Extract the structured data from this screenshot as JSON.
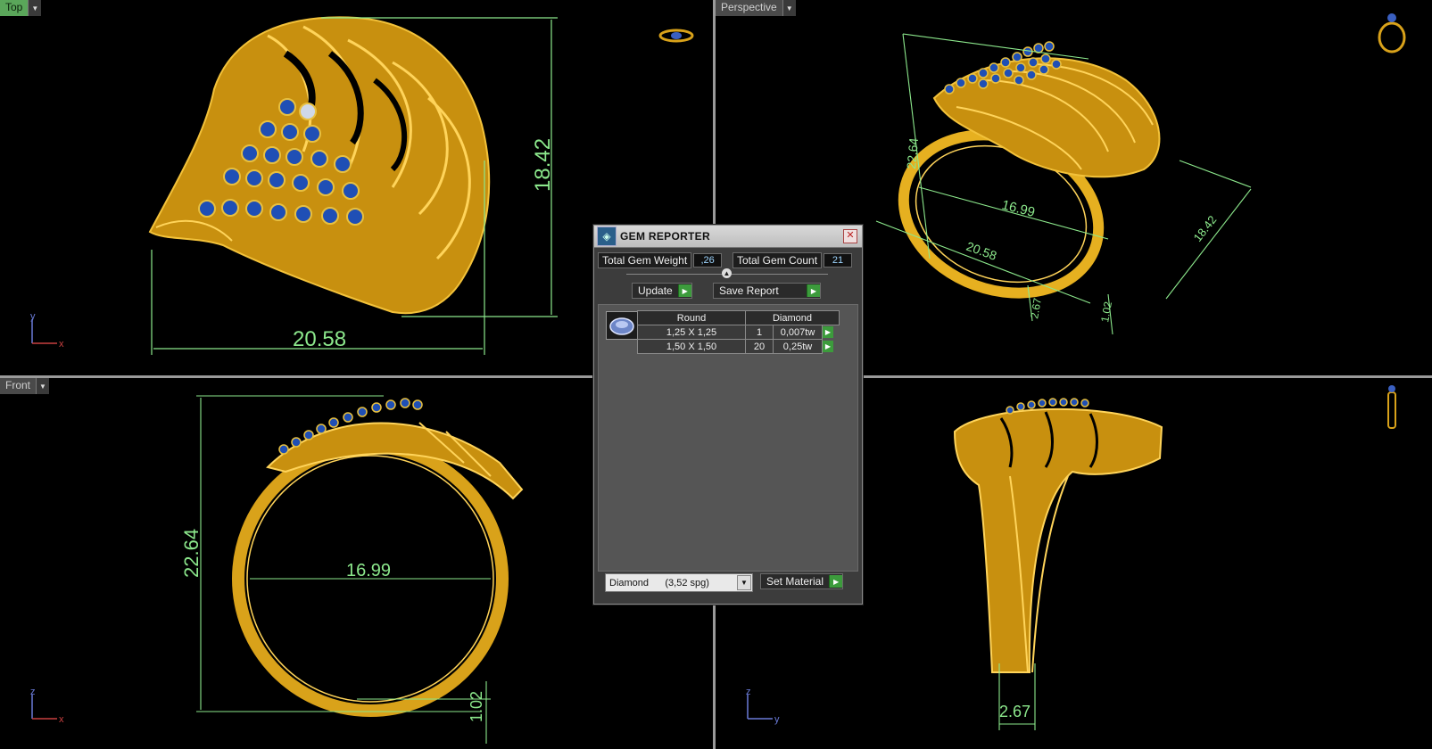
{
  "viewports": {
    "top": {
      "label": "Top",
      "dims": {
        "width": "20.58",
        "height": "18.42"
      },
      "axes": {
        "a": "y",
        "b": "x"
      }
    },
    "perspective": {
      "label": "Perspective",
      "dims": {
        "a": "22.64",
        "b": "16.99",
        "c": "20.58",
        "d": "18.42",
        "e": "2.67",
        "f": "1.02"
      }
    },
    "front": {
      "label": "Front",
      "dims": {
        "height": "22.64",
        "inner": "16.99",
        "bottom": "1.02"
      },
      "axes": {
        "a": "z",
        "b": "x"
      }
    },
    "right": {
      "dims": {
        "bottom": "2.67"
      },
      "axes": {
        "a": "z",
        "b": "y"
      }
    }
  },
  "gem_reporter": {
    "title": "GEM REPORTER",
    "total_weight_label": "Total Gem Weight",
    "total_weight_value": ",26",
    "total_count_label": "Total Gem Count",
    "total_count_value": "21",
    "update_label": "Update",
    "save_label": "Save Report",
    "table": {
      "header": {
        "shape": "Round",
        "stone": "Diamond"
      },
      "rows": [
        {
          "size": "1,25 X 1,25",
          "count": "1",
          "weight": "0,007tw"
        },
        {
          "size": "1,50 X 1,50",
          "count": "20",
          "weight": "0,25tw"
        }
      ]
    },
    "material_value": "Diamond      (3,52 spg)",
    "set_material_label": "Set Material"
  },
  "colors": {
    "gold": "#d9a21a",
    "gem": "#1f4fb5",
    "dimension": "#8ce88c"
  }
}
